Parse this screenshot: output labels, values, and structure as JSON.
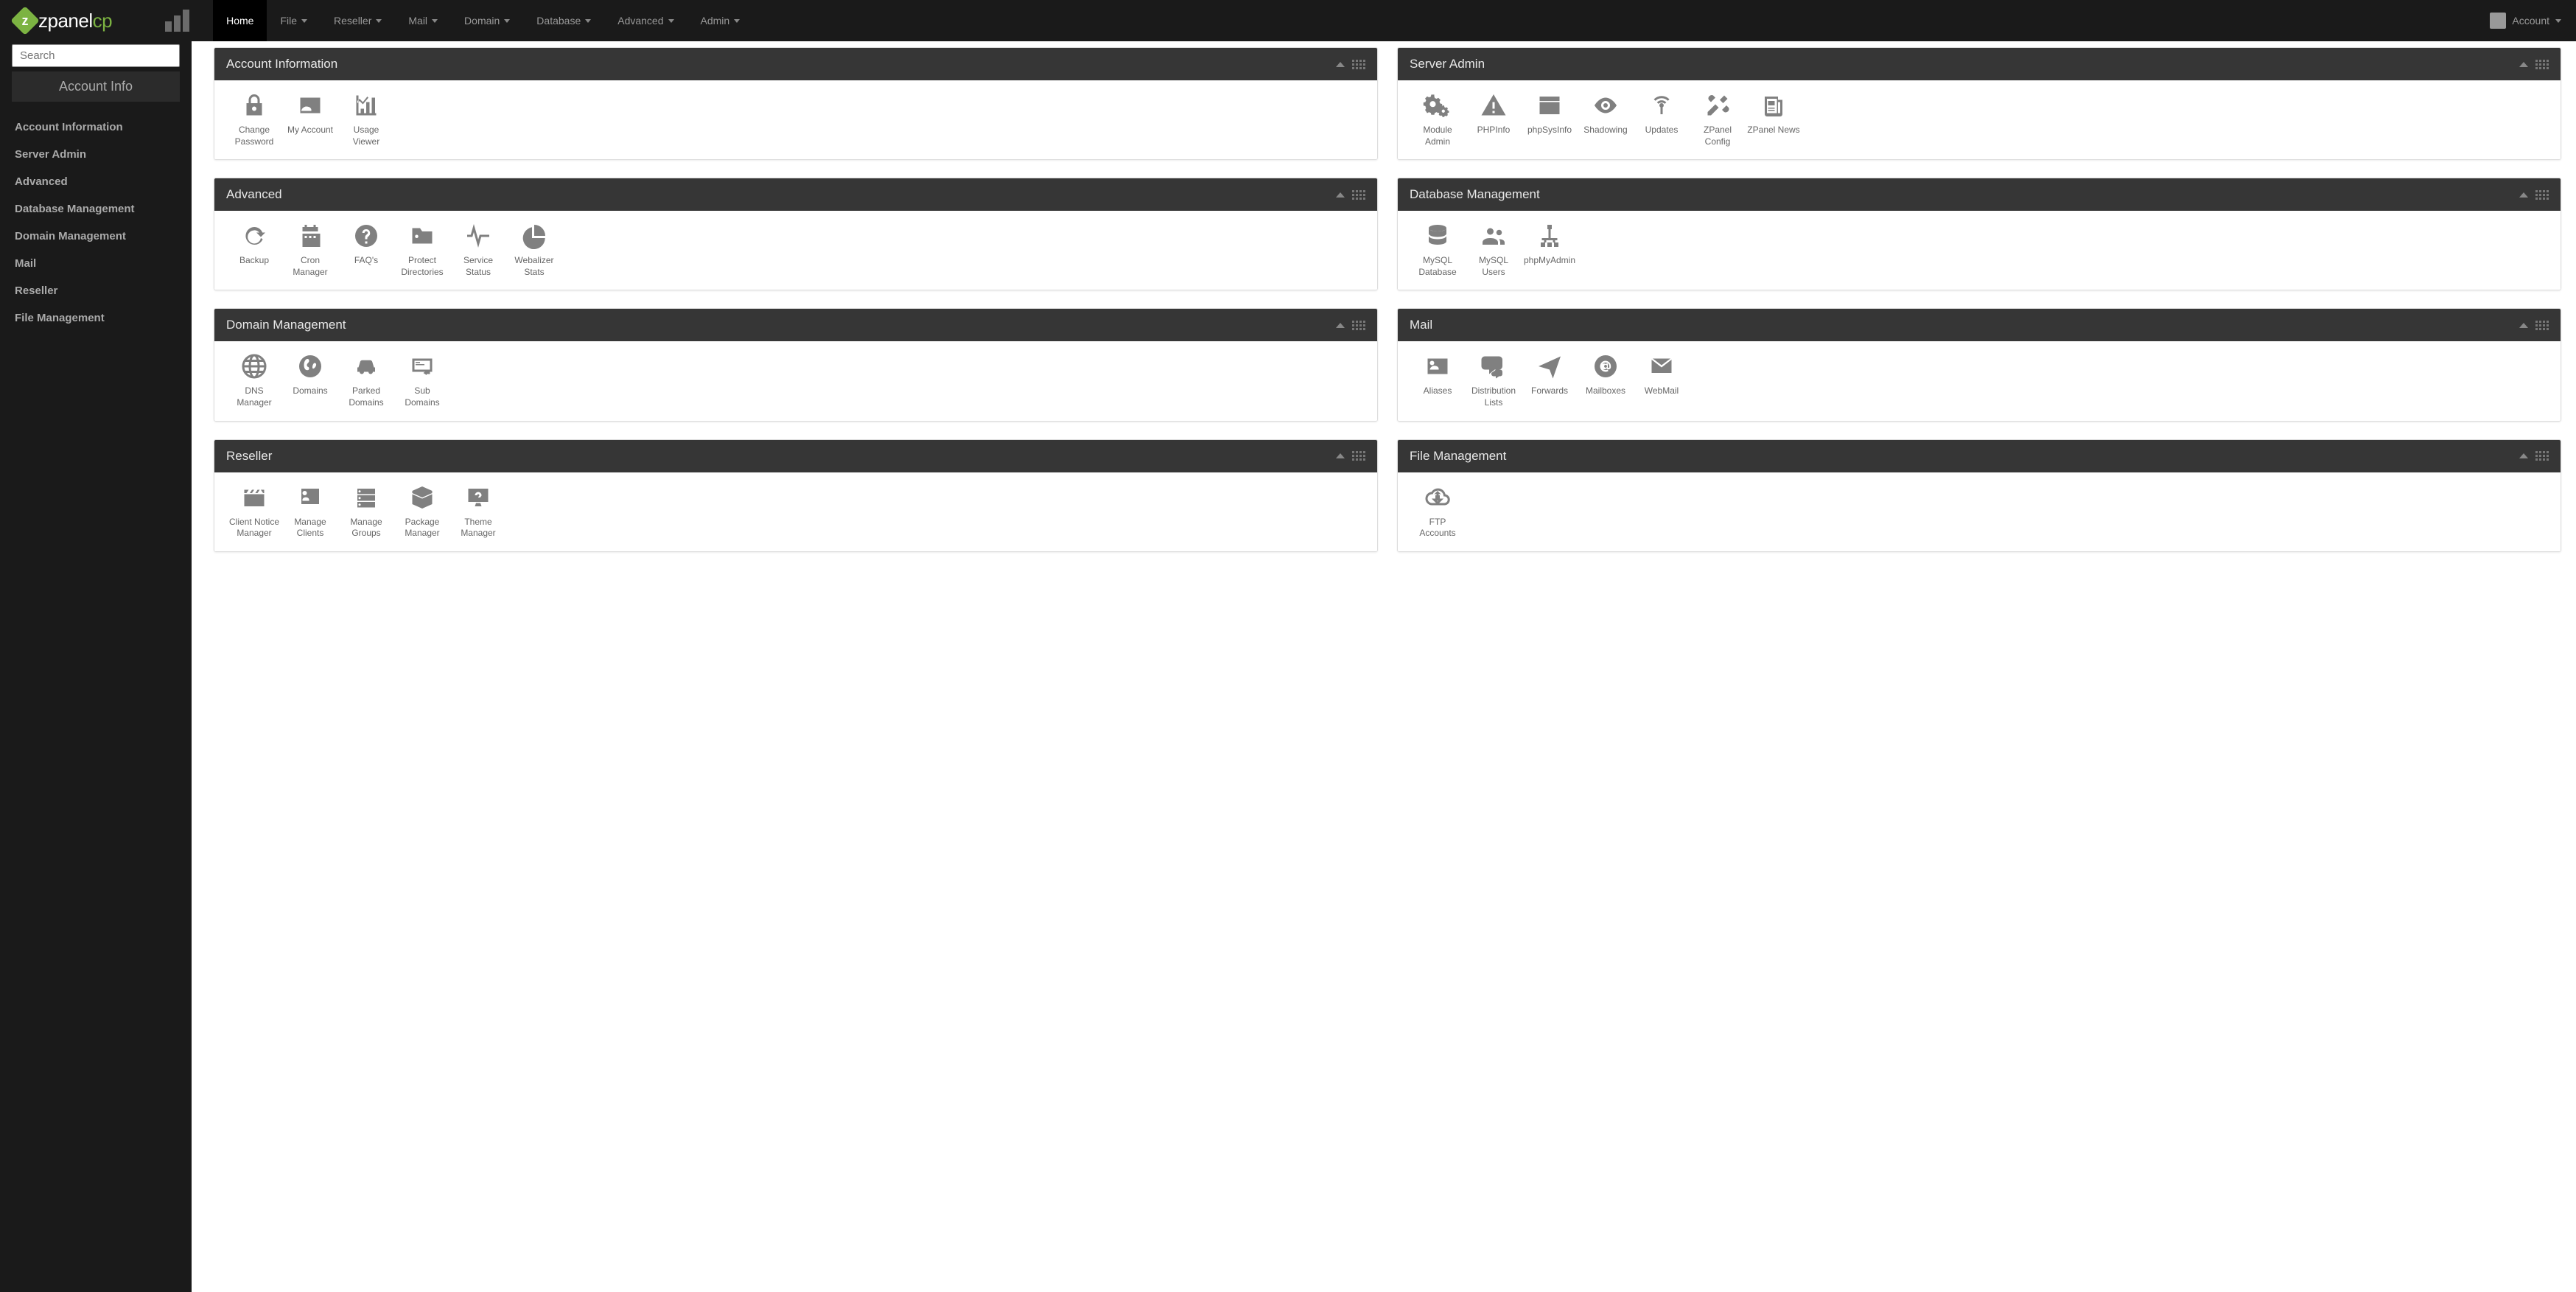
{
  "brand": {
    "name_a": "zpanel",
    "name_b": "cp"
  },
  "nav": {
    "home": "Home",
    "file": "File",
    "reseller": "Reseller",
    "mail": "Mail",
    "domain": "Domain",
    "database": "Database",
    "advanced": "Advanced",
    "admin": "Admin",
    "account": "Account"
  },
  "sidebar": {
    "search_placeholder": "Search",
    "account_info_btn": "Account Info",
    "links": {
      "account_information": "Account Information",
      "server_admin": "Server Admin",
      "advanced": "Advanced",
      "database_management": "Database Management",
      "domain_management": "Domain Management",
      "mail": "Mail",
      "reseller": "Reseller",
      "file_management": "File Management"
    }
  },
  "panels": {
    "account_information": {
      "title": "Account Information",
      "items": {
        "change_password": "Change Password",
        "my_account": "My Account",
        "usage_viewer": "Usage Viewer"
      }
    },
    "server_admin": {
      "title": "Server Admin",
      "items": {
        "module_admin": "Module Admin",
        "phpinfo": "PHPInfo",
        "phpsysinfo": "phpSysInfo",
        "shadowing": "Shadowing",
        "updates": "Updates",
        "zpanel_config": "ZPanel Config",
        "zpanel_news": "ZPanel News"
      }
    },
    "advanced": {
      "title": "Advanced",
      "items": {
        "backup": "Backup",
        "cron_manager": "Cron Manager",
        "faqs": "FAQ's",
        "protect_directories": "Protect Directories",
        "service_status": "Service Status",
        "webalizer_stats": "Webalizer Stats"
      }
    },
    "database_management": {
      "title": "Database Management",
      "items": {
        "mysql_database": "MySQL Database",
        "mysql_users": "MySQL Users",
        "phpmyadmin": "phpMyAdmin"
      }
    },
    "domain_management": {
      "title": "Domain Management",
      "items": {
        "dns_manager": "DNS Manager",
        "domains": "Domains",
        "parked_domains": "Parked Domains",
        "sub_domains": "Sub Domains"
      }
    },
    "mail": {
      "title": "Mail",
      "items": {
        "aliases": "Aliases",
        "distribution_lists": "Distribution Lists",
        "forwards": "Forwards",
        "mailboxes": "Mailboxes",
        "webmail": "WebMail"
      }
    },
    "reseller": {
      "title": "Reseller",
      "items": {
        "client_notice_manager": "Client Notice Manager",
        "manage_clients": "Manage Clients",
        "manage_groups": "Manage Groups",
        "package_manager": "Package Manager",
        "theme_manager": "Theme Manager"
      }
    },
    "file_management": {
      "title": "File Management",
      "items": {
        "ftp_accounts": "FTP Accounts"
      }
    }
  }
}
